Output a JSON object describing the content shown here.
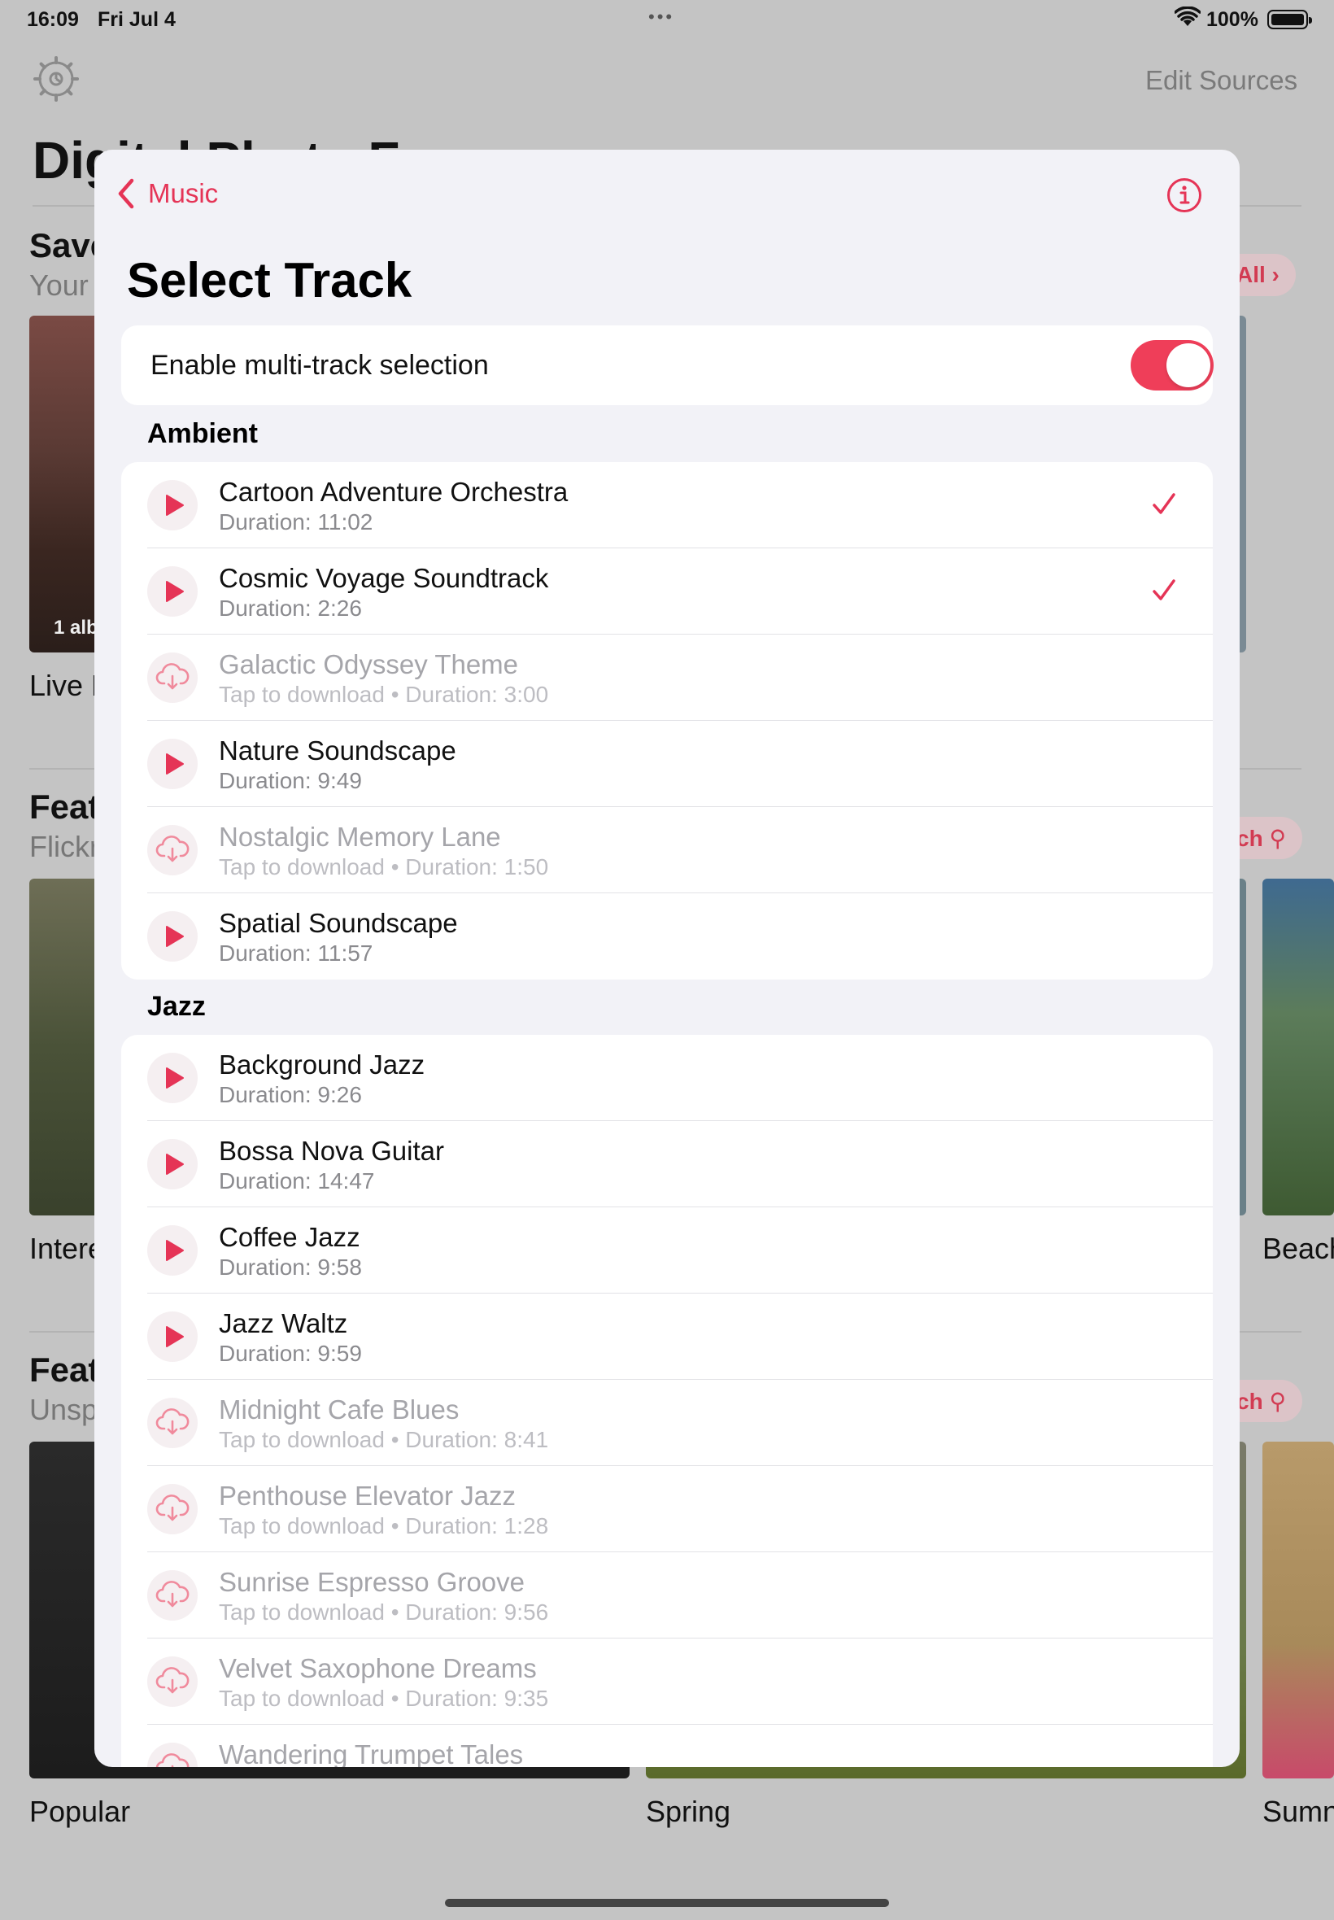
{
  "status": {
    "time": "16:09",
    "date": "Fri Jul 4",
    "battery": "100%"
  },
  "background": {
    "edit_sources": "Edit Sources",
    "title": "Digital Photo F",
    "section1": {
      "head": "Save",
      "sub": "Your",
      "pill": "All",
      "count": "1 alb",
      "caption": "Live F"
    },
    "section2": {
      "head": "Feat",
      "sub": "Flickr",
      "pill": "ch",
      "caption1": "Intere",
      "caption2": "Beach"
    },
    "section3": {
      "head": "Feat",
      "sub": "Unsp",
      "pill": "ch",
      "caption1": "Popular",
      "caption2": "Spring",
      "caption3": "Sumn"
    }
  },
  "sheet": {
    "back_label": "Music",
    "title": "Select Track",
    "toggle_label": "Enable multi-track selection",
    "toggle_on": true
  },
  "sections": [
    {
      "title": "Ambient",
      "tracks": [
        {
          "name": "Cartoon Adventure Orchestra",
          "detail": "Duration: 11:02",
          "downloaded": true,
          "selected": true
        },
        {
          "name": "Cosmic Voyage Soundtrack",
          "detail": "Duration: 2:26",
          "downloaded": true,
          "selected": true
        },
        {
          "name": "Galactic Odyssey Theme",
          "detail": "Tap to download • Duration: 3:00",
          "downloaded": false,
          "selected": false
        },
        {
          "name": "Nature Soundscape",
          "detail": "Duration: 9:49",
          "downloaded": true,
          "selected": false
        },
        {
          "name": "Nostalgic Memory Lane",
          "detail": "Tap to download • Duration: 1:50",
          "downloaded": false,
          "selected": false
        },
        {
          "name": "Spatial Soundscape",
          "detail": "Duration: 11:57",
          "downloaded": true,
          "selected": false
        }
      ]
    },
    {
      "title": "Jazz",
      "tracks": [
        {
          "name": "Background Jazz",
          "detail": "Duration: 9:26",
          "downloaded": true,
          "selected": false
        },
        {
          "name": "Bossa Nova Guitar",
          "detail": "Duration: 14:47",
          "downloaded": true,
          "selected": false
        },
        {
          "name": "Coffee Jazz",
          "detail": "Duration: 9:58",
          "downloaded": true,
          "selected": false
        },
        {
          "name": "Jazz Waltz",
          "detail": "Duration: 9:59",
          "downloaded": true,
          "selected": false
        },
        {
          "name": "Midnight Cafe Blues",
          "detail": "Tap to download • Duration: 8:41",
          "downloaded": false,
          "selected": false
        },
        {
          "name": "Penthouse Elevator Jazz",
          "detail": "Tap to download • Duration: 1:28",
          "downloaded": false,
          "selected": false
        },
        {
          "name": "Sunrise Espresso Groove",
          "detail": "Tap to download • Duration: 9:56",
          "downloaded": false,
          "selected": false
        },
        {
          "name": "Velvet Saxophone Dreams",
          "detail": "Tap to download • Duration: 9:35",
          "downloaded": false,
          "selected": false
        },
        {
          "name": "Wandering Trumpet Tales",
          "detail": "",
          "downloaded": false,
          "selected": false
        }
      ]
    }
  ],
  "colors": {
    "accent": "#e53456",
    "toggle": "#ef3e59"
  },
  "icons": {
    "play": "play-icon",
    "download": "cloud-download-icon",
    "check": "checkmark-icon",
    "back": "chevron-left-icon",
    "info": "info-icon",
    "settings": "gear-icon"
  }
}
